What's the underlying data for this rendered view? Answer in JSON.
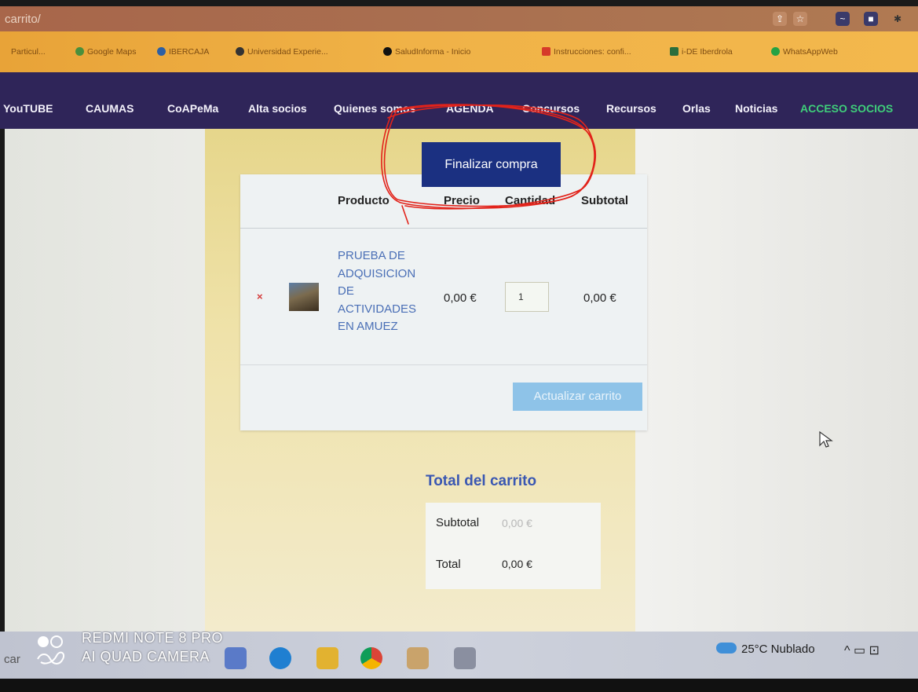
{
  "browser": {
    "url_fragment": "carrito/",
    "bookmarks": [
      {
        "label": "Particul...",
        "color": "#9c6a2a"
      },
      {
        "label": "Google Maps",
        "color": "#4a8f3c"
      },
      {
        "label": "IBERCAJA",
        "color": "#2d5fa3"
      },
      {
        "label": "Universidad Experie...",
        "color": "#333333"
      },
      {
        "label": "SaludInforma - Inicio",
        "color": "#111111"
      },
      {
        "label": "Instrucciones: confi...",
        "color": "#d63a2a"
      },
      {
        "label": "i-DE Iberdrola",
        "color": "#2c6e3c"
      },
      {
        "label": "WhatsAppWeb",
        "color": "#25a244"
      }
    ]
  },
  "navbar": {
    "items": [
      "YouTUBE",
      "CAUMAS",
      "CoAPeMa",
      "Alta socios",
      "Quienes somos",
      "AGENDA",
      "Concursos",
      "Recursos",
      "Orlas",
      "Noticias",
      "ACCESO SOCIOS"
    ],
    "highlight_color": "#3fcf7a"
  },
  "cart": {
    "checkout_button": "Finalizar compra",
    "columns": {
      "product": "Producto",
      "price": "Precio",
      "quantity": "Cantidad",
      "subtotal": "Subtotal"
    },
    "rows": [
      {
        "remove": "×",
        "product_lines": [
          "PRUEBA DE",
          "ADQUISICION",
          "DE",
          "ACTIVIDADES",
          "EN AMUEZ"
        ],
        "price": "0,00 €",
        "quantity": "1",
        "subtotal": "0,00 €"
      }
    ],
    "update_button": "Actualizar carrito"
  },
  "totals": {
    "title": "Total del carrito",
    "subtotal_label": "Subtotal",
    "subtotal_value": "0,00 €",
    "total_label": "Total",
    "total_value": "0,00 €"
  },
  "taskbar": {
    "search_stub": "car",
    "weather": "25°C  Nublado",
    "tray": "^"
  },
  "watermark": {
    "line1": "REDMI NOTE 8 PRO",
    "line2": "AI QUAD CAMERA"
  }
}
